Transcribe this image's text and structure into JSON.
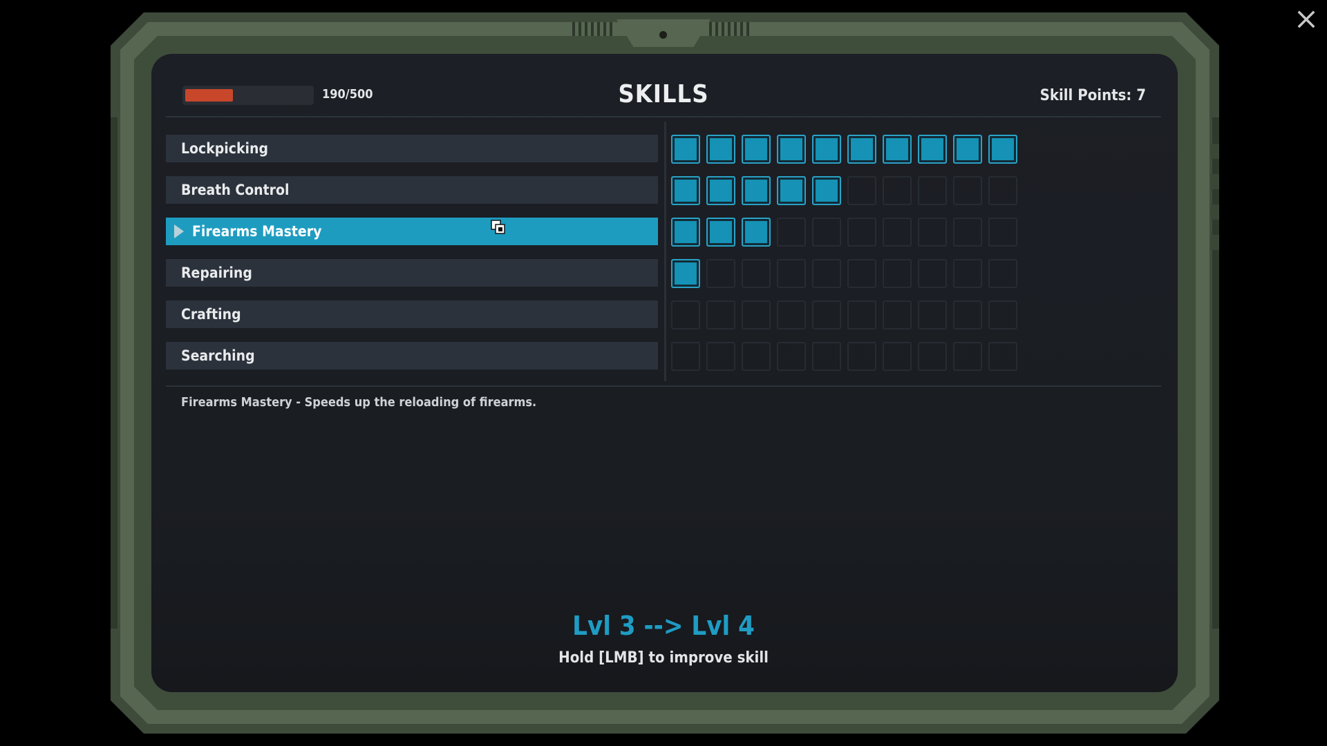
{
  "window": {
    "close_icon": "close-icon"
  },
  "header": {
    "title": "SKILLS",
    "xp_text": "190/500",
    "xp_current": 190,
    "xp_max": 500,
    "skill_points": "Skill Points: 7"
  },
  "skills": [
    {
      "label": "Lockpicking",
      "level": 10,
      "selected": false
    },
    {
      "label": "Breath Control",
      "level": 5,
      "selected": false
    },
    {
      "label": "Firearms Mastery",
      "level": 3,
      "selected": true
    },
    {
      "label": "Repairing",
      "level": 1,
      "selected": false
    },
    {
      "label": "Crafting",
      "level": 0,
      "selected": false
    },
    {
      "label": "Searching",
      "level": 0,
      "selected": false
    }
  ],
  "max_level": 10,
  "description": "Firearms Mastery - Speeds up the reloading of firearms.",
  "upgrade": {
    "level_change": "Lvl 3 --> Lvl 4",
    "hint": "Hold [LMB] to improve skill"
  },
  "colors": {
    "accent": "#1e9cc0",
    "xp_fill": "#c8472b",
    "frame": "#566650",
    "background": "#1c1f25"
  }
}
